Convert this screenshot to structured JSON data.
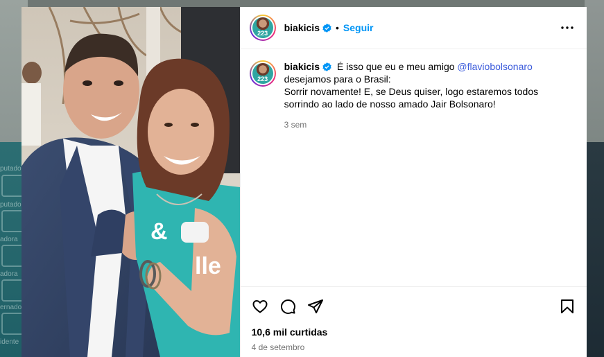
{
  "background": {
    "side_labels": [
      "putado",
      "putado",
      "adora",
      "adora",
      "ernado",
      "idente"
    ]
  },
  "post": {
    "username": "biakicis",
    "follow_label": "Seguir",
    "dot": "•",
    "avatar_number": "223",
    "caption": {
      "username": "biakicis",
      "lines": [
        "É isso que eu e meu amigo ",
        "@flaviobolsonaro",
        "desejamos para o Brasil:",
        "Sorrir novamente! E, se Deus quiser, logo estaremos todos",
        "sorrindo ao lado de nosso amado Jair Bolsonaro!"
      ],
      "time_ago": "3 sem"
    },
    "likes": "10,6 mil curtidas",
    "date": "4 de setembro",
    "photo_shirt_text": [
      "&",
      "lle"
    ]
  },
  "colors": {
    "accent": "#0095f6",
    "verified": "#0095f6",
    "shirt": "#2fb5b1"
  },
  "icons": [
    "verified-icon",
    "more-options-icon",
    "heart-icon",
    "comment-icon",
    "share-icon",
    "bookmark-icon"
  ]
}
